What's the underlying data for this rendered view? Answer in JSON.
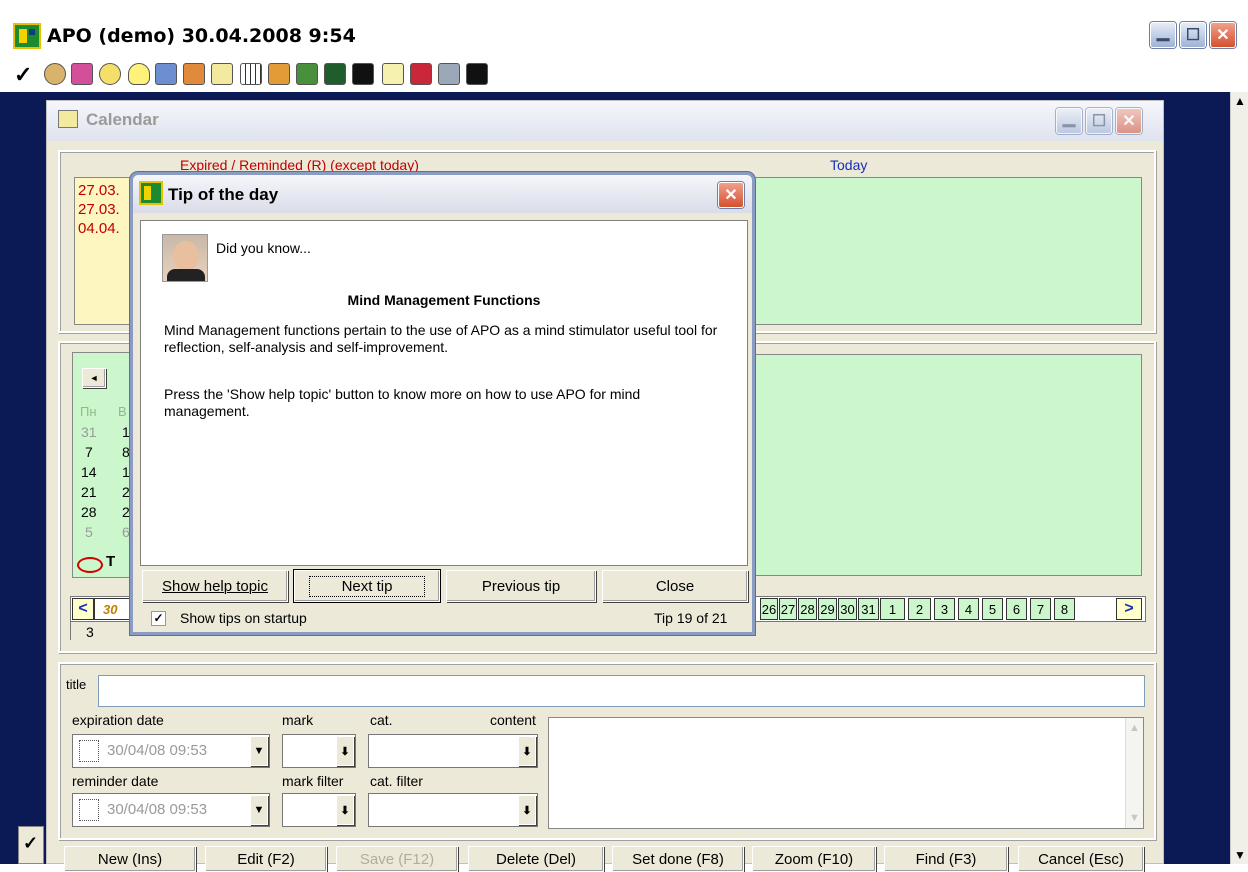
{
  "app": {
    "title": "APO (demo) 30.04.2008 9:54"
  },
  "toolbar": {
    "icons": [
      "check-icon",
      "money-bag-icon",
      "puzzle-icon",
      "smiley-icon",
      "lightbulb-icon",
      "pencil-cup-icon",
      "book-icon",
      "calendar-icon",
      "grid-icon",
      "chart-icon",
      "tree-icon",
      "image-icon",
      "black-card-icon",
      "note-icon",
      "stamp-icon",
      "tools-icon",
      "black-box-icon"
    ]
  },
  "calendar": {
    "title": "Calendar",
    "expired_header": "Expired / Reminded (R) (except today)",
    "today_header": "Today",
    "expired_items": [
      "27.03.",
      "27.03.",
      "04.04."
    ],
    "nav_prev": "◄",
    "weekday_first": "Пн",
    "weekday_second": "В",
    "weeks": [
      [
        "31",
        "1"
      ],
      [
        "7",
        "8"
      ],
      [
        "14",
        "1"
      ],
      [
        "21",
        "2"
      ],
      [
        "28",
        "2"
      ],
      [
        "5",
        "6"
      ]
    ],
    "today_marker": "T",
    "strip_prev": "<",
    "strip_first": "30",
    "strip_days": [
      "26",
      "27",
      "28",
      "29",
      "30",
      "31",
      "1",
      "2",
      "3",
      "4",
      "5",
      "6",
      "7",
      "8"
    ],
    "strip_next": ">",
    "row_number": "3"
  },
  "form": {
    "title_label": "title",
    "title_value": "",
    "expiration_label": "expiration date",
    "expiration_value": "30/04/08 09:53",
    "mark_label": "mark",
    "cat_label": "cat.",
    "content_label": "content",
    "reminder_label": "reminder date",
    "reminder_value": "30/04/08 09:53",
    "mark_filter_label": "mark filter",
    "cat_filter_label": "cat. filter"
  },
  "buttons": {
    "new": "New (Ins)",
    "edit": "Edit (F2)",
    "save": "Save (F12)",
    "delete": "Delete (Del)",
    "set_done": "Set done (F8)",
    "zoom": "Zoom (F10)",
    "find": "Find (F3)",
    "cancel": "Cancel (Esc)"
  },
  "dialog": {
    "title": "Tip of the day",
    "did_you_know": "Did you know...",
    "heading": "Mind Management Functions",
    "para1": "Mind Management functions pertain to the use of APO as a mind stimulator useful tool for reflection, self-analysis and self-improvement.",
    "para2": "Press the 'Show help topic' button to know more on how to use APO for mind management.",
    "show_help": "Show help topic",
    "next_tip": "Next tip",
    "previous_tip": "Previous tip",
    "close": "Close",
    "show_tips_label": "Show tips on startup",
    "show_tips_checked": true,
    "tip_counter": "Tip 19 of 21"
  },
  "colors": {
    "desktop": "#0b1a55",
    "green": "#ccf7cc",
    "yellow": "#fdf6c0",
    "accent_red": "#c00000",
    "link_blue": "#1a2db0"
  }
}
